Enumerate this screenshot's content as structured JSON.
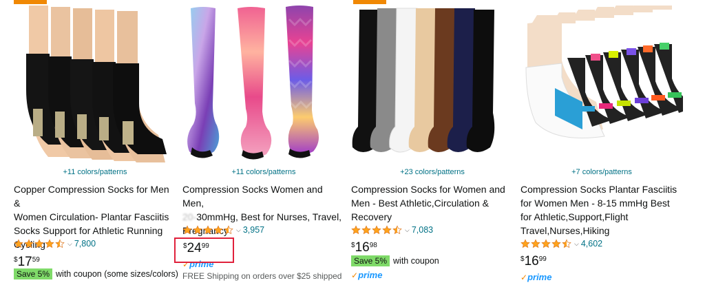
{
  "products": [
    {
      "colors_link": "+11 colors/patterns",
      "title_lines": [
        "Copper Compression Socks for Men &",
        "Women Circulation- Plantar Fasciitis",
        "Socks Support for Athletic Running",
        "Cycling"
      ],
      "rating": 4.5,
      "review_count": "7,800",
      "price": {
        "symbol": "$",
        "whole": "17",
        "fraction": "59"
      },
      "coupon": {
        "badge": "Save 5%",
        "text": "with coupon (some sizes/colors)"
      }
    },
    {
      "colors_link": "+11 colors/patterns",
      "title_lines": [
        "Compression Socks Women and Men,",
        "20-30mmHg, Best for Nurses, Travel,",
        "Pregnancy"
      ],
      "rating": 4.5,
      "review_count": "3,957",
      "price": {
        "symbol": "$",
        "whole": "24",
        "fraction": "99"
      },
      "prime_label": "prime",
      "shipping": "FREE Shipping on orders over $25 shipped"
    },
    {
      "colors_link": "+23 colors/patterns",
      "title_lines": [
        "Compression Socks for Women and",
        "Men - Best Athletic,Circulation &",
        "Recovery"
      ],
      "rating": 4.5,
      "review_count": "7,083",
      "price": {
        "symbol": "$",
        "whole": "16",
        "fraction": "98"
      },
      "coupon": {
        "badge": "Save 5%",
        "text": "with coupon"
      },
      "prime_label": "prime"
    },
    {
      "colors_link": "+7 colors/patterns",
      "title_lines": [
        "Compression Socks Plantar Fasciitis",
        "for Women Men - 8-15 mmHg Best",
        "for Athletic,Support,Flight",
        "Travel,Nurses,Hiking"
      ],
      "rating": 4.5,
      "review_count": "4,602",
      "price": {
        "symbol": "$",
        "whole": "16",
        "fraction": "99"
      },
      "prime_label": "prime"
    }
  ],
  "colors": {
    "link": "#007185",
    "star": "#ffa41c",
    "save_badge": "#7fda69",
    "prime": "#1a98ff",
    "highlight": "#e0203b",
    "badge_strip": "#f08804"
  }
}
